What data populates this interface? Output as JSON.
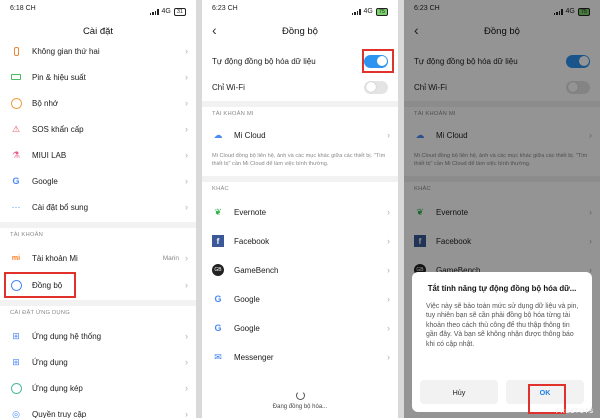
{
  "colors": {
    "toggle_on": "#2c93f0",
    "highlight": "#e0312c",
    "ok_text": "#1f7ee8"
  },
  "screen1": {
    "time": "6:18 CH",
    "battery": "31",
    "title": "Cài đặt",
    "items_top": [
      {
        "label": "Không gian thứ hai",
        "icon": "second-space-icon"
      },
      {
        "label": "Pin & hiệu suất",
        "icon": "battery-icon"
      },
      {
        "label": "Bộ nhớ",
        "icon": "storage-icon"
      },
      {
        "label": "SOS khẩn cấp",
        "icon": "sos-icon"
      },
      {
        "label": "MIUI LAB",
        "icon": "lab-icon"
      },
      {
        "label": "Google",
        "icon": "google-icon"
      },
      {
        "label": "Cài đặt bổ sung",
        "icon": "more-icon"
      }
    ],
    "section_account": "TÀI KHOẢN",
    "account_items": [
      {
        "label": "Tài khoản Mi",
        "value": "Marin",
        "icon": "mi-icon"
      },
      {
        "label": "Đồng bộ",
        "value": "",
        "icon": "sync-icon"
      }
    ],
    "section_apps": "CÀI ĐẶT ỨNG DỤNG",
    "app_items": [
      {
        "label": "Ứng dụng hệ thống",
        "icon": "system-apps-icon"
      },
      {
        "label": "Ứng dụng",
        "icon": "apps-icon"
      },
      {
        "label": "Ứng dụng kép",
        "icon": "dual-apps-icon"
      },
      {
        "label": "Quyền truy cập",
        "icon": "permissions-icon"
      }
    ]
  },
  "screen2": {
    "time": "6:23 CH",
    "battery": "75",
    "title": "Đồng bộ",
    "auto_sync_label": "Tự động đồng bộ hóa dữ liệu",
    "wifi_only_label": "Chỉ Wi-Fi",
    "section_mi": "TÀI KHOẢN MI",
    "mi_cloud_label": "Mi Cloud",
    "mi_note": "Mi Cloud đồng bộ liên hệ, ảnh và các mục khác giữa các thiết bị. \"Tìm thiết bị\" cần Mi Cloud để làm việc bình thường.",
    "section_other": "KHÁC",
    "other_items": [
      {
        "label": "Evernote",
        "icon": "evernote-icon"
      },
      {
        "label": "Facebook",
        "icon": "facebook-icon"
      },
      {
        "label": "GameBench",
        "icon": "gamebench-icon"
      },
      {
        "label": "Google",
        "icon": "google-icon"
      },
      {
        "label": "Google",
        "icon": "google-icon"
      },
      {
        "label": "Messenger",
        "icon": "messenger-icon"
      }
    ],
    "syncing_text": "Đang đồng bộ hóa..."
  },
  "screen3": {
    "time": "6:23 CH",
    "battery": "75",
    "title": "Đồng bộ",
    "auto_sync_label": "Tự động đồng bộ hóa dữ liệu",
    "wifi_only_label": "Chỉ Wi-Fi",
    "section_mi": "TÀI KHOẢN MI",
    "mi_cloud_label": "Mi Cloud",
    "mi_note": "Mi Cloud đồng bộ liên hệ, ảnh và các mục khác giữa các thiết bị. \"Tìm thiết bị\" cần Mi Cloud để làm việc bình thường.",
    "section_other": "KHÁC",
    "other_items": [
      {
        "label": "Evernote",
        "icon": "evernote-icon"
      },
      {
        "label": "Facebook",
        "icon": "facebook-icon"
      },
      {
        "label": "GameBench",
        "icon": "gamebench-icon"
      }
    ],
    "dialog": {
      "title": "Tắt tính năng tự động đồng bộ hóa dữ...",
      "body": "Việc này sẽ bảo toàn mức sử dụng dữ liệu và pin, tuy nhiên bạn sẽ cần phải đồng bộ hóa từng tài khoản theo cách thủ công để thu thập thông tin gần đây. Và bạn sẽ không nhận được thông báo khi có cập nhật.",
      "cancel": "Hủy",
      "ok": "OK"
    },
    "watermark": "FREETUTS"
  }
}
